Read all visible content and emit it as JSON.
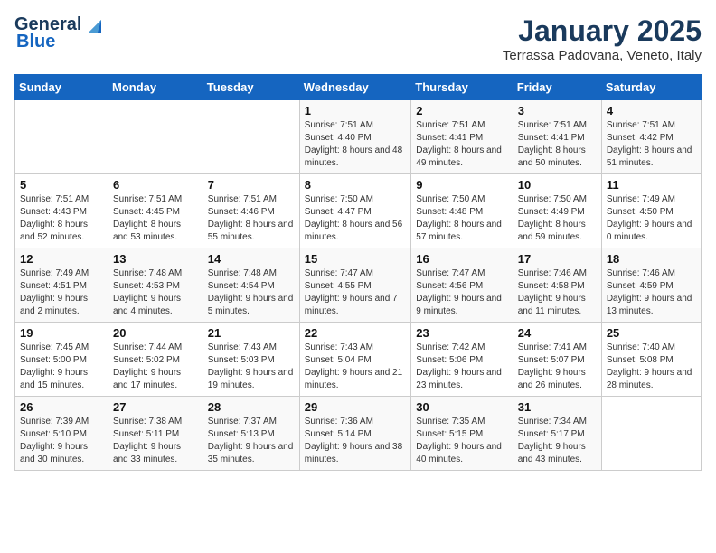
{
  "header": {
    "logo_general": "General",
    "logo_blue": "Blue",
    "month": "January 2025",
    "location": "Terrassa Padovana, Veneto, Italy"
  },
  "weekdays": [
    "Sunday",
    "Monday",
    "Tuesday",
    "Wednesday",
    "Thursday",
    "Friday",
    "Saturday"
  ],
  "weeks": [
    [
      {
        "day": "",
        "detail": ""
      },
      {
        "day": "",
        "detail": ""
      },
      {
        "day": "",
        "detail": ""
      },
      {
        "day": "1",
        "detail": "Sunrise: 7:51 AM\nSunset: 4:40 PM\nDaylight: 8 hours\nand 48 minutes."
      },
      {
        "day": "2",
        "detail": "Sunrise: 7:51 AM\nSunset: 4:41 PM\nDaylight: 8 hours\nand 49 minutes."
      },
      {
        "day": "3",
        "detail": "Sunrise: 7:51 AM\nSunset: 4:41 PM\nDaylight: 8 hours\nand 50 minutes."
      },
      {
        "day": "4",
        "detail": "Sunrise: 7:51 AM\nSunset: 4:42 PM\nDaylight: 8 hours\nand 51 minutes."
      }
    ],
    [
      {
        "day": "5",
        "detail": "Sunrise: 7:51 AM\nSunset: 4:43 PM\nDaylight: 8 hours\nand 52 minutes."
      },
      {
        "day": "6",
        "detail": "Sunrise: 7:51 AM\nSunset: 4:45 PM\nDaylight: 8 hours\nand 53 minutes."
      },
      {
        "day": "7",
        "detail": "Sunrise: 7:51 AM\nSunset: 4:46 PM\nDaylight: 8 hours\nand 55 minutes."
      },
      {
        "day": "8",
        "detail": "Sunrise: 7:50 AM\nSunset: 4:47 PM\nDaylight: 8 hours\nand 56 minutes."
      },
      {
        "day": "9",
        "detail": "Sunrise: 7:50 AM\nSunset: 4:48 PM\nDaylight: 8 hours\nand 57 minutes."
      },
      {
        "day": "10",
        "detail": "Sunrise: 7:50 AM\nSunset: 4:49 PM\nDaylight: 8 hours\nand 59 minutes."
      },
      {
        "day": "11",
        "detail": "Sunrise: 7:49 AM\nSunset: 4:50 PM\nDaylight: 9 hours\nand 0 minutes."
      }
    ],
    [
      {
        "day": "12",
        "detail": "Sunrise: 7:49 AM\nSunset: 4:51 PM\nDaylight: 9 hours\nand 2 minutes."
      },
      {
        "day": "13",
        "detail": "Sunrise: 7:48 AM\nSunset: 4:53 PM\nDaylight: 9 hours\nand 4 minutes."
      },
      {
        "day": "14",
        "detail": "Sunrise: 7:48 AM\nSunset: 4:54 PM\nDaylight: 9 hours\nand 5 minutes."
      },
      {
        "day": "15",
        "detail": "Sunrise: 7:47 AM\nSunset: 4:55 PM\nDaylight: 9 hours\nand 7 minutes."
      },
      {
        "day": "16",
        "detail": "Sunrise: 7:47 AM\nSunset: 4:56 PM\nDaylight: 9 hours\nand 9 minutes."
      },
      {
        "day": "17",
        "detail": "Sunrise: 7:46 AM\nSunset: 4:58 PM\nDaylight: 9 hours\nand 11 minutes."
      },
      {
        "day": "18",
        "detail": "Sunrise: 7:46 AM\nSunset: 4:59 PM\nDaylight: 9 hours\nand 13 minutes."
      }
    ],
    [
      {
        "day": "19",
        "detail": "Sunrise: 7:45 AM\nSunset: 5:00 PM\nDaylight: 9 hours\nand 15 minutes."
      },
      {
        "day": "20",
        "detail": "Sunrise: 7:44 AM\nSunset: 5:02 PM\nDaylight: 9 hours\nand 17 minutes."
      },
      {
        "day": "21",
        "detail": "Sunrise: 7:43 AM\nSunset: 5:03 PM\nDaylight: 9 hours\nand 19 minutes."
      },
      {
        "day": "22",
        "detail": "Sunrise: 7:43 AM\nSunset: 5:04 PM\nDaylight: 9 hours\nand 21 minutes."
      },
      {
        "day": "23",
        "detail": "Sunrise: 7:42 AM\nSunset: 5:06 PM\nDaylight: 9 hours\nand 23 minutes."
      },
      {
        "day": "24",
        "detail": "Sunrise: 7:41 AM\nSunset: 5:07 PM\nDaylight: 9 hours\nand 26 minutes."
      },
      {
        "day": "25",
        "detail": "Sunrise: 7:40 AM\nSunset: 5:08 PM\nDaylight: 9 hours\nand 28 minutes."
      }
    ],
    [
      {
        "day": "26",
        "detail": "Sunrise: 7:39 AM\nSunset: 5:10 PM\nDaylight: 9 hours\nand 30 minutes."
      },
      {
        "day": "27",
        "detail": "Sunrise: 7:38 AM\nSunset: 5:11 PM\nDaylight: 9 hours\nand 33 minutes."
      },
      {
        "day": "28",
        "detail": "Sunrise: 7:37 AM\nSunset: 5:13 PM\nDaylight: 9 hours\nand 35 minutes."
      },
      {
        "day": "29",
        "detail": "Sunrise: 7:36 AM\nSunset: 5:14 PM\nDaylight: 9 hours\nand 38 minutes."
      },
      {
        "day": "30",
        "detail": "Sunrise: 7:35 AM\nSunset: 5:15 PM\nDaylight: 9 hours\nand 40 minutes."
      },
      {
        "day": "31",
        "detail": "Sunrise: 7:34 AM\nSunset: 5:17 PM\nDaylight: 9 hours\nand 43 minutes."
      },
      {
        "day": "",
        "detail": ""
      }
    ]
  ]
}
